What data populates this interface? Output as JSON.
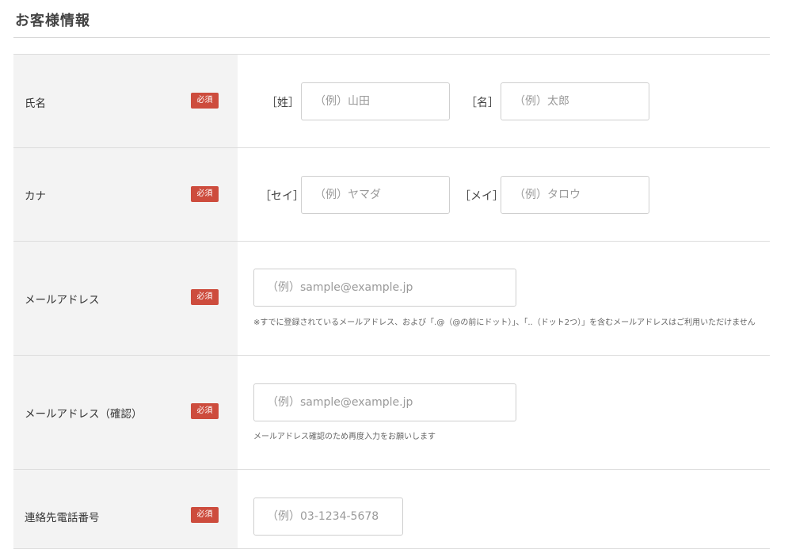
{
  "section": {
    "title": "お客様情報"
  },
  "required_label": "必須",
  "rows": {
    "name": {
      "label": "氏名",
      "last_prefix": "［姓］",
      "last_placeholder": "（例）山田",
      "first_prefix": "［名］",
      "first_placeholder": "（例）太郎"
    },
    "kana": {
      "label": "カナ",
      "last_prefix": "［セイ］",
      "last_placeholder": "（例）ヤマダ",
      "first_prefix": "［メイ］",
      "first_placeholder": "（例）タロウ"
    },
    "email": {
      "label": "メールアドレス",
      "placeholder": "（例）sample@example.jp",
      "note": "※すでに登録されているメールアドレス、および「.@（@の前にドット）」、「..（ドット2つ）」を含むメールアドレスはご利用いただけません"
    },
    "email_confirm": {
      "label": "メールアドレス（確認）",
      "placeholder": "（例）sample@example.jp",
      "note": "メールアドレス確認のため再度入力をお願いします"
    },
    "phone": {
      "label": "連絡先電話番号",
      "placeholder": "（例）03-1234-5678"
    }
  },
  "colors": {
    "badge": "#cd4c3d",
    "label_bg": "#f3f3f3",
    "border": "#dddddd"
  }
}
